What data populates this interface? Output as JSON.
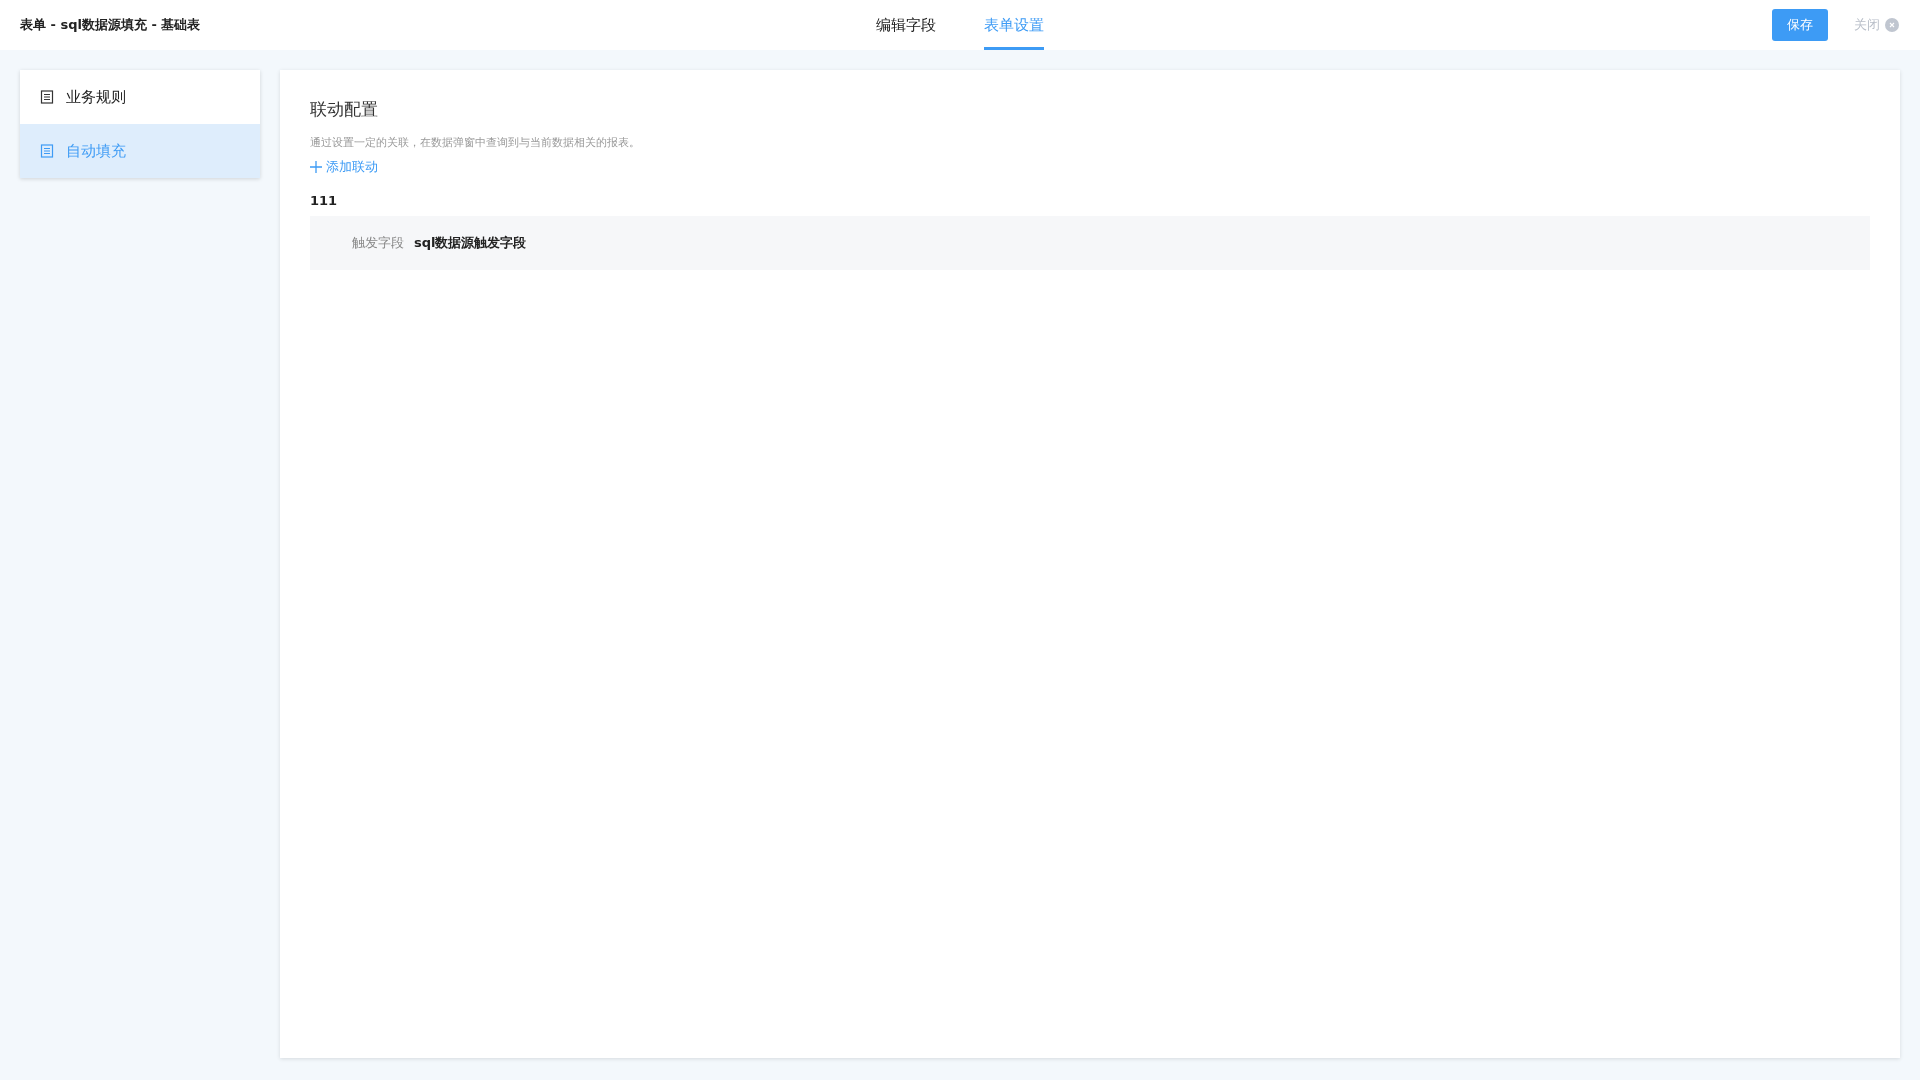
{
  "header": {
    "title": "表单 - sql数据源填充 - 基础表",
    "tabs": [
      {
        "label": "编辑字段",
        "selected": false
      },
      {
        "label": "表单设置",
        "selected": true
      }
    ],
    "save_button": "保存",
    "close_button": "关闭"
  },
  "sidebar": {
    "items": [
      {
        "label": "业务规则",
        "selected": false
      },
      {
        "label": "自动填充",
        "selected": true
      }
    ]
  },
  "panel": {
    "title": "联动配置",
    "description": "通过设置一定的关联，在数据弹窗中查询到与当前数据相关的报表。",
    "add_link": "添加联动",
    "linkages": [
      {
        "name": "111",
        "field_label": "触发字段",
        "field_value": "sql数据源触发字段"
      }
    ]
  }
}
